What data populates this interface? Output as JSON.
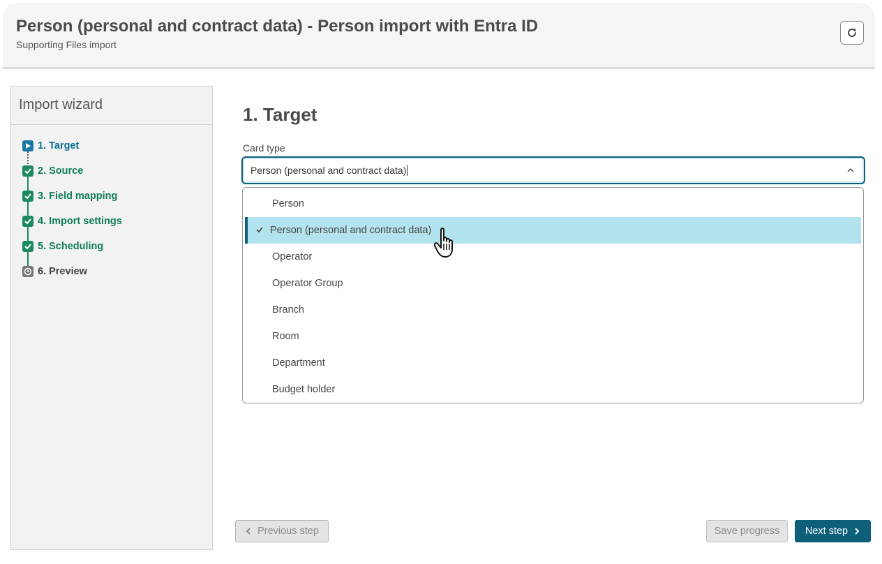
{
  "header": {
    "title": "Person (personal and contract data) - Person import with Entra ID",
    "subtitle": "Supporting Files import",
    "refresh_icon": "refresh-icon"
  },
  "sidebar": {
    "title": "Import wizard",
    "steps": [
      {
        "label": "1. Target",
        "state": "active",
        "icon": "play-icon"
      },
      {
        "label": "2. Source",
        "state": "done",
        "icon": "check-icon"
      },
      {
        "label": "3. Field mapping",
        "state": "done",
        "icon": "check-icon"
      },
      {
        "label": "4. Import settings",
        "state": "done",
        "icon": "check-icon"
      },
      {
        "label": "5. Scheduling",
        "state": "done",
        "icon": "check-icon"
      },
      {
        "label": "6. Preview",
        "state": "pending",
        "icon": "clock-icon"
      }
    ]
  },
  "main": {
    "title": "1. Target",
    "card_type": {
      "label": "Card type",
      "value": "Person (personal and contract data)",
      "options": [
        "Person",
        "Person (personal and contract data)",
        "Operator",
        "Operator Group",
        "Branch",
        "Room",
        "Department",
        "Budget holder"
      ],
      "selected_index": 1
    }
  },
  "footer": {
    "previous_label": "Previous step",
    "save_label": "Save progress",
    "next_label": "Next step"
  },
  "colors": {
    "accent": "#0d5f7a",
    "active_step": "#1877a4",
    "done_step": "#1a8a5e",
    "selected_option_bg": "#b3e3ee"
  }
}
